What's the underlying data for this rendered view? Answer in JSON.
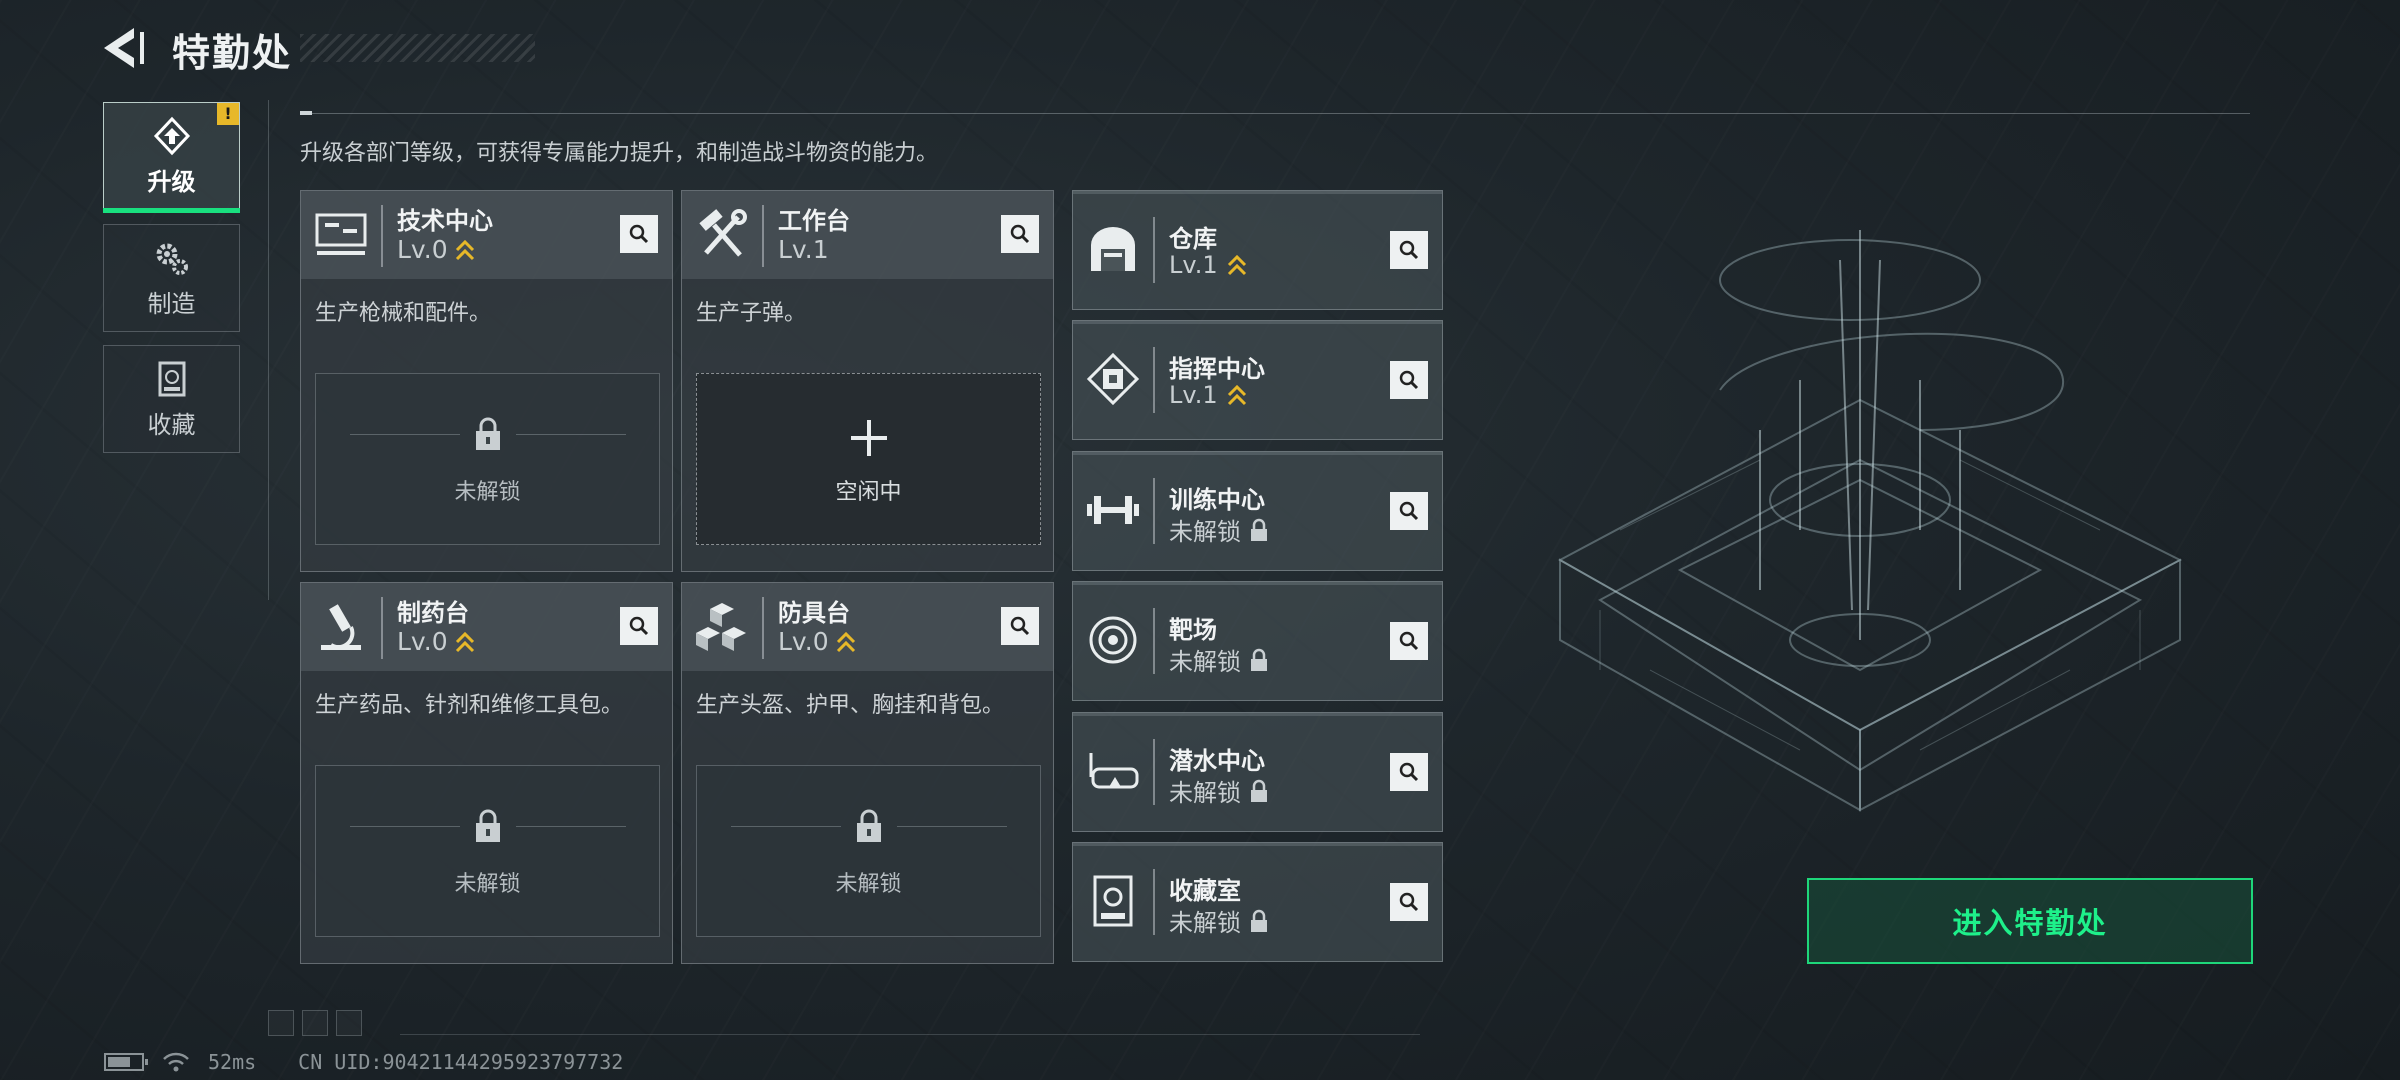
{
  "header": {
    "title": "特勤处"
  },
  "sidebar": {
    "items": [
      {
        "label": "升级",
        "active": true,
        "badge": "!"
      },
      {
        "label": "制造",
        "active": false
      },
      {
        "label": "收藏",
        "active": false
      }
    ]
  },
  "description": "升级各部门等级，可获得专属能力提升，和制造战斗物资的能力。",
  "workshops": [
    {
      "name": "技术中心",
      "level": "Lv.0",
      "desc": "生产枪械和配件。",
      "slot_status": "未解锁",
      "icon": "monitor-icon"
    },
    {
      "name": "工作台",
      "level": "Lv.1",
      "desc": "生产子弹。",
      "slot_status": "空闲中",
      "icon": "hammer-wrench-icon"
    },
    {
      "name": "制药台",
      "level": "Lv.0",
      "desc": "生产药品、针剂和维修工具包。",
      "slot_status": "未解锁",
      "icon": "microscope-icon"
    },
    {
      "name": "防具台",
      "level": "Lv.0",
      "desc": "生产头盔、护甲、胸挂和背包。",
      "slot_status": "未解锁",
      "icon": "armor-blocks-icon"
    }
  ],
  "facilities": [
    {
      "name": "仓库",
      "level": "Lv.1",
      "icon": "warehouse-icon"
    },
    {
      "name": "指挥中心",
      "level": "Lv.1",
      "icon": "command-chip-icon"
    },
    {
      "name": "训练中心",
      "level": "未解锁",
      "icon": "dumbbell-icon"
    },
    {
      "name": "靶场",
      "level": "未解锁",
      "icon": "target-icon"
    },
    {
      "name": "潜水中心",
      "level": "未解锁",
      "icon": "diving-mask-icon"
    },
    {
      "name": "收藏室",
      "level": "未解锁",
      "icon": "display-case-icon"
    }
  ],
  "enter_button": "进入特勤处",
  "status_bar": {
    "ping": "52ms",
    "uid": "CN UID:904211442959237977​32"
  },
  "colors": {
    "accent": "#1ed77a",
    "upgrade_chevron": "#e7b829",
    "badge": "#e7b829"
  }
}
